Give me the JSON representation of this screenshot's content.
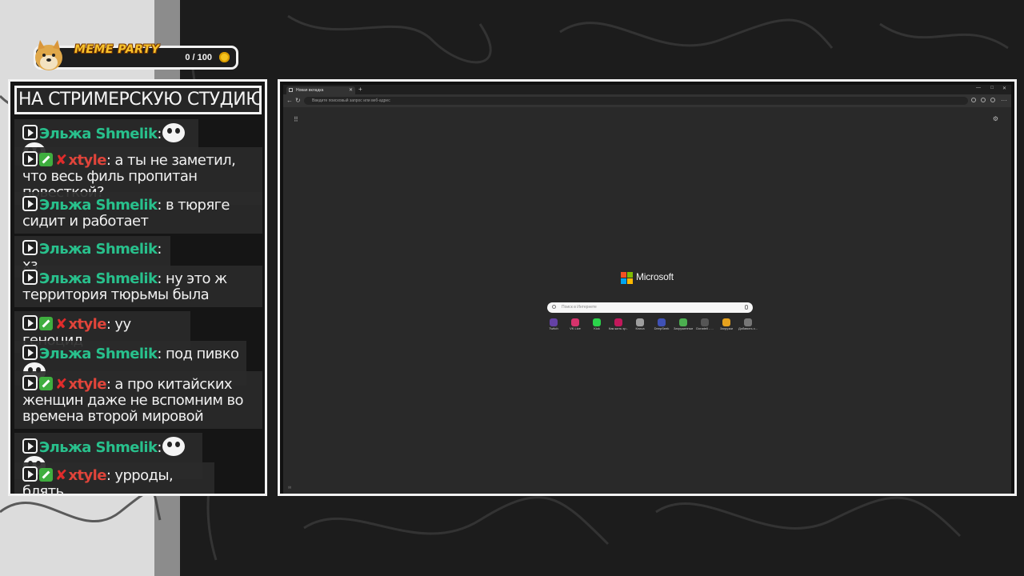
{
  "meme_widget": {
    "title": "MEME PARTY",
    "counter": "0 / 100"
  },
  "chat": {
    "header": "НА СТРИМЕРСКУЮ СТУДИЮ",
    "messages": [
      {
        "user": "Эльжа Shmelik",
        "sep": ":",
        "text": ""
      },
      {
        "user": "xtyle",
        "sep": ":",
        "text": " а ты не заметил, что весь филь пропитан повесткой?"
      },
      {
        "user": "Эльжа Shmelik",
        "sep": ":",
        "text": " в тюряге сидит и работает"
      },
      {
        "user": "Эльжа Shmelik",
        "sep": ":",
        "text": " хз"
      },
      {
        "user": "Эльжа Shmelik",
        "sep": ":",
        "text": " ну это ж территория тюрьмы была"
      },
      {
        "user": "xtyle",
        "sep": ":",
        "text": " уу геноцид"
      },
      {
        "user": "Эльжа Shmelik",
        "sep": ":",
        "text": " под пивко"
      },
      {
        "user": "xtyle",
        "sep": ":",
        "text": " а про китайских женщин даже не вспомним во времена второй мировой"
      },
      {
        "user": "Эльжа Shmelik",
        "sep": ":",
        "text": ""
      },
      {
        "user": "xtyle",
        "sep": ":",
        "text": " урроды, блять"
      }
    ]
  },
  "browser": {
    "tab_title": "Новая вкладка",
    "address_placeholder": "Введите поисковый запрос или веб-адрес",
    "logo_text": "Microsoft",
    "search_placeholder": "Поиск в Интернете",
    "tiles": [
      {
        "label": "Twitch",
        "color": "#6441a5"
      },
      {
        "label": "VK Live",
        "color": "#d6336c"
      },
      {
        "label": "Kick",
        "color": "#2bd34b"
      },
      {
        "label": "Как жить хр...",
        "color": "#c2185b"
      },
      {
        "label": "Клиса",
        "color": "#9e9e9e"
      },
      {
        "label": "DeepSeek",
        "color": "#3f51b5"
      },
      {
        "label": "Загруженные",
        "color": "#4caf50"
      },
      {
        "label": "Donatell - ...",
        "color": "#555555"
      },
      {
        "label": "Загрузки",
        "color": "#e6a21e"
      },
      {
        "label": "Добавить с...",
        "color": "#777777"
      }
    ]
  },
  "colors": {
    "green_name": "#28c08c",
    "red_name": "#e0443a",
    "border": "#f2f2f2",
    "coin": "#f3c21e"
  }
}
